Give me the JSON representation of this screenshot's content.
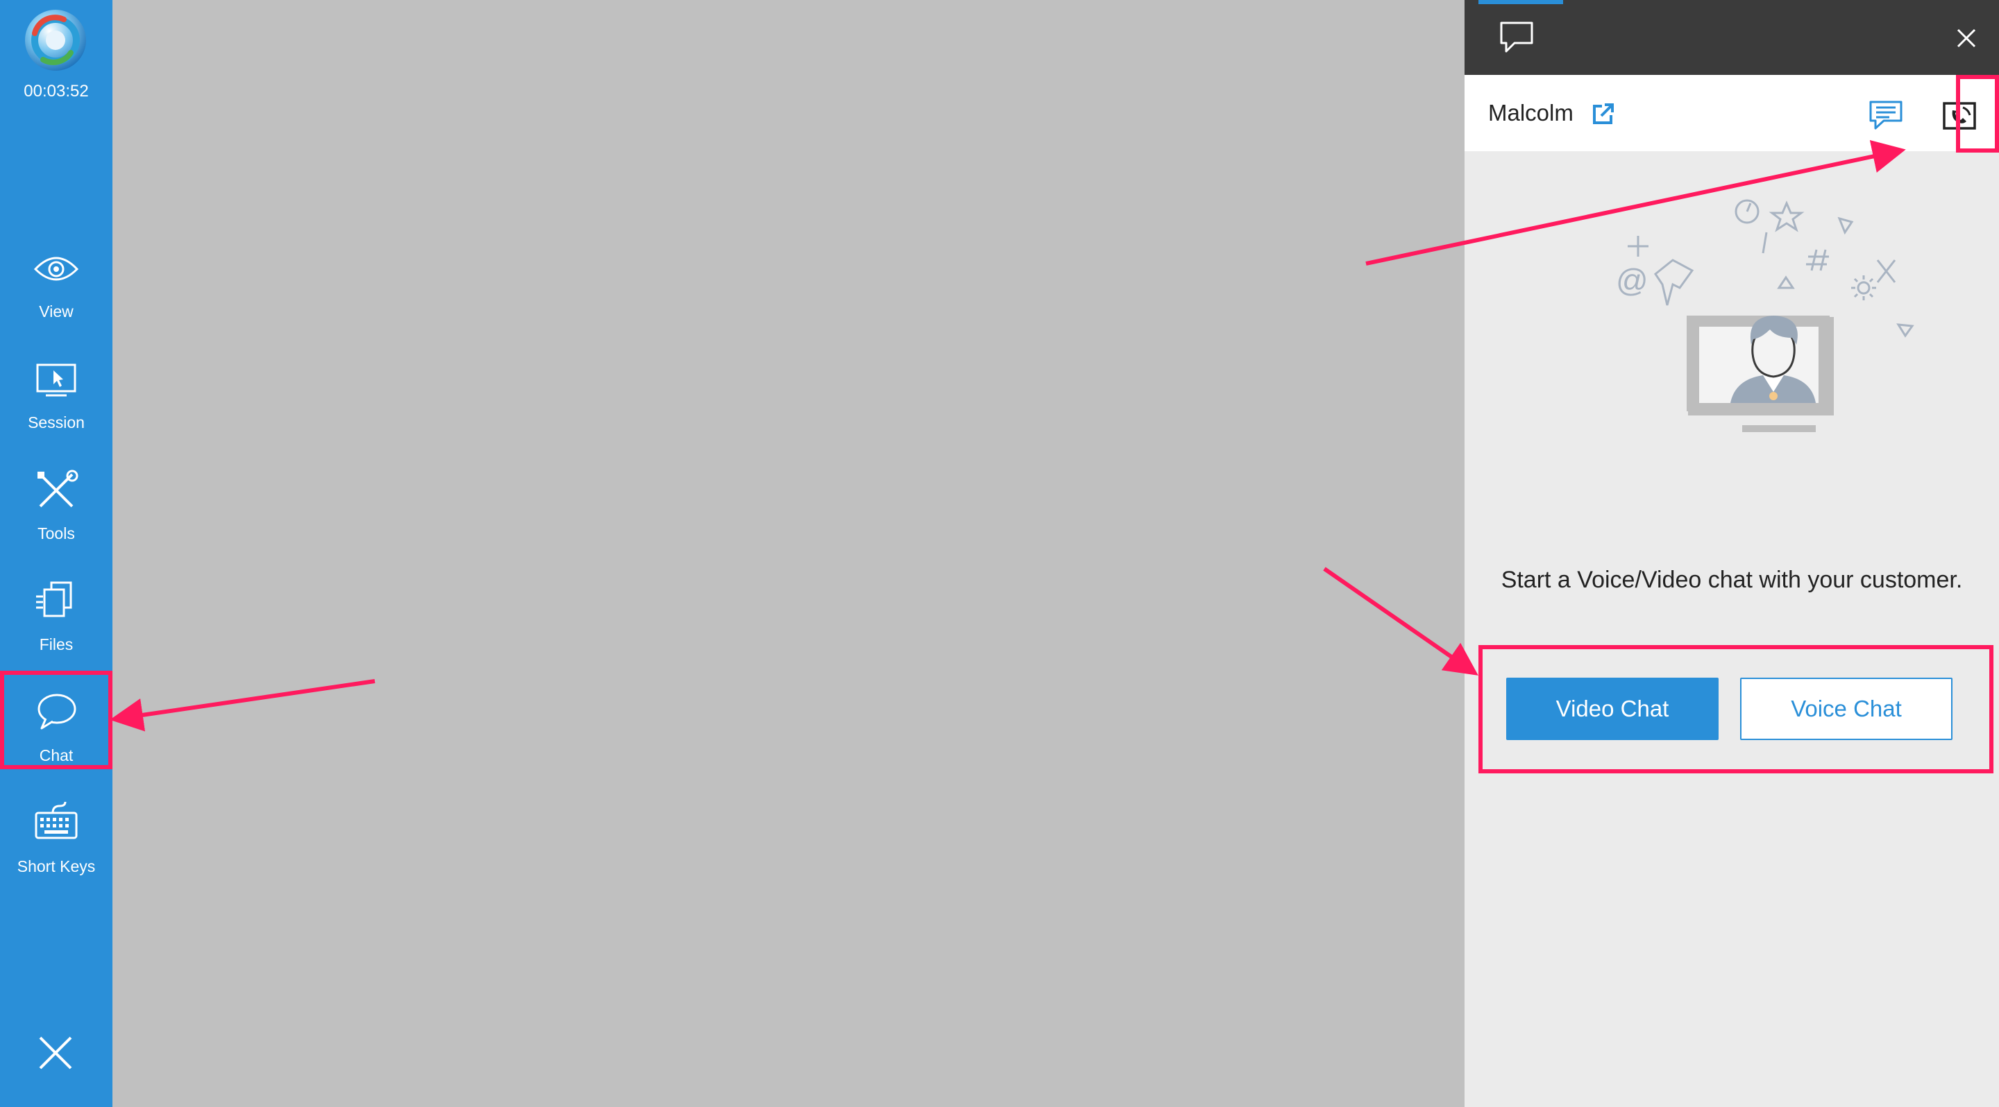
{
  "sidebar": {
    "timer": "00:03:52",
    "items": [
      {
        "label": "View",
        "icon": "eye-icon"
      },
      {
        "label": "Session",
        "icon": "monitor-cursor-icon"
      },
      {
        "label": "Tools",
        "icon": "wrench-screwdriver-icon"
      },
      {
        "label": "Files",
        "icon": "files-icon"
      },
      {
        "label": "Chat",
        "icon": "speech-bubble-icon"
      },
      {
        "label": "Short Keys",
        "icon": "keyboard-icon"
      }
    ],
    "close_icon": "close-icon"
  },
  "panel": {
    "customer_name": "Malcolm",
    "message": "Start a Voice/Video chat with your customer.",
    "video_button": "Video Chat",
    "voice_button": "Voice Chat"
  },
  "colors": {
    "sidebar": "#2a8fd8",
    "accent": "#2a8fd8",
    "highlight": "#ff1a5e",
    "panel_top": "#3b3b3b",
    "panel_bg": "#ebebeb",
    "canvas": "#c0c0c0"
  }
}
